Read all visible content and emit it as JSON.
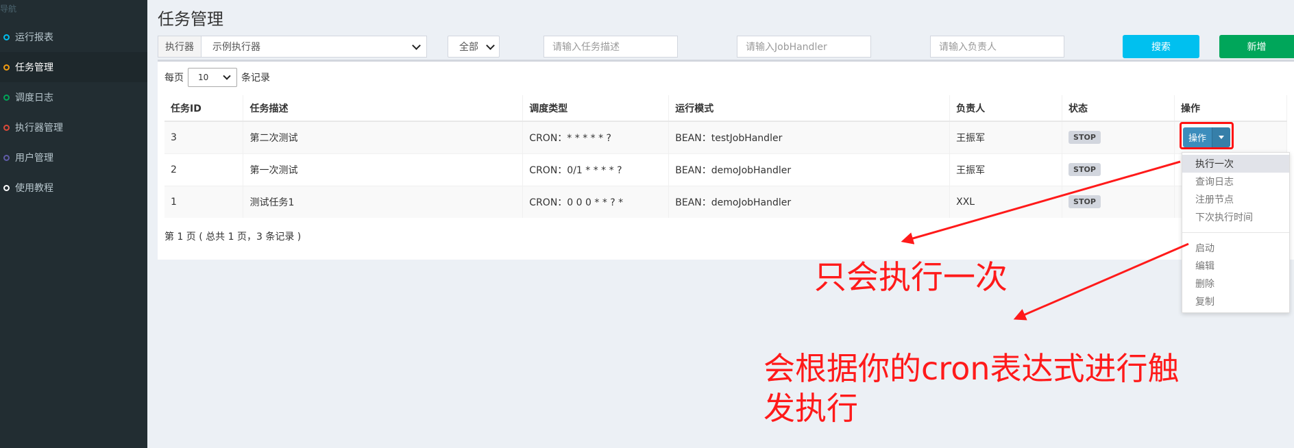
{
  "sidebar": {
    "header": "导航",
    "items": [
      {
        "label": "运行报表",
        "color": "#00c0ef"
      },
      {
        "label": "任务管理",
        "color": "#f39c12"
      },
      {
        "label": "调度日志",
        "color": "#00a65a"
      },
      {
        "label": "执行器管理",
        "color": "#dd4b39"
      },
      {
        "label": "用户管理",
        "color": "#605ca8"
      },
      {
        "label": "使用教程",
        "color": "#ffffff"
      }
    ]
  },
  "page": {
    "title": "任务管理"
  },
  "filters": {
    "executor_label": "执行器",
    "executor_value": "示例执行器",
    "status_value": "全部",
    "desc_placeholder": "请输入任务描述",
    "handler_placeholder": "请输入JobHandler",
    "author_placeholder": "请输入负责人",
    "search_label": "搜索",
    "add_label": "新增",
    "search_color": "#00c0ef",
    "add_color": "#00a65a"
  },
  "perpage": {
    "prefix": "每页",
    "value": "10",
    "suffix": "条记录"
  },
  "table": {
    "headers": [
      "任务ID",
      "任务描述",
      "调度类型",
      "运行模式",
      "负责人",
      "状态",
      "操作"
    ],
    "rows": [
      {
        "id": "3",
        "desc": "第二次测试",
        "cron": "CRON：* * * * * ?",
        "mode": "BEAN：testJobHandler",
        "author": "王振军",
        "status": "STOP"
      },
      {
        "id": "2",
        "desc": "第一次测试",
        "cron": "CRON：0/1 * * * * ?",
        "mode": "BEAN：demoJobHandler",
        "author": "王振军",
        "status": "STOP"
      },
      {
        "id": "1",
        "desc": "测试任务1",
        "cron": "CRON：0 0 0 * * ? *",
        "mode": "BEAN：demoJobHandler",
        "author": "XXL",
        "status": "STOP"
      }
    ],
    "info": "第 1 页 ( 总共 1 页，3 条记录 )"
  },
  "operation": {
    "button_label": "操作",
    "menu": [
      "执行一次",
      "查询日志",
      "注册节点",
      "下次执行时间"
    ],
    "menu2": [
      "启动",
      "编辑",
      "删除",
      "复制"
    ]
  },
  "annotations": {
    "once": "只会执行一次",
    "cron_line1": "会根据你的cron表达式进行触",
    "cron_line2": "发执行",
    "color": "#ff1a1a"
  }
}
